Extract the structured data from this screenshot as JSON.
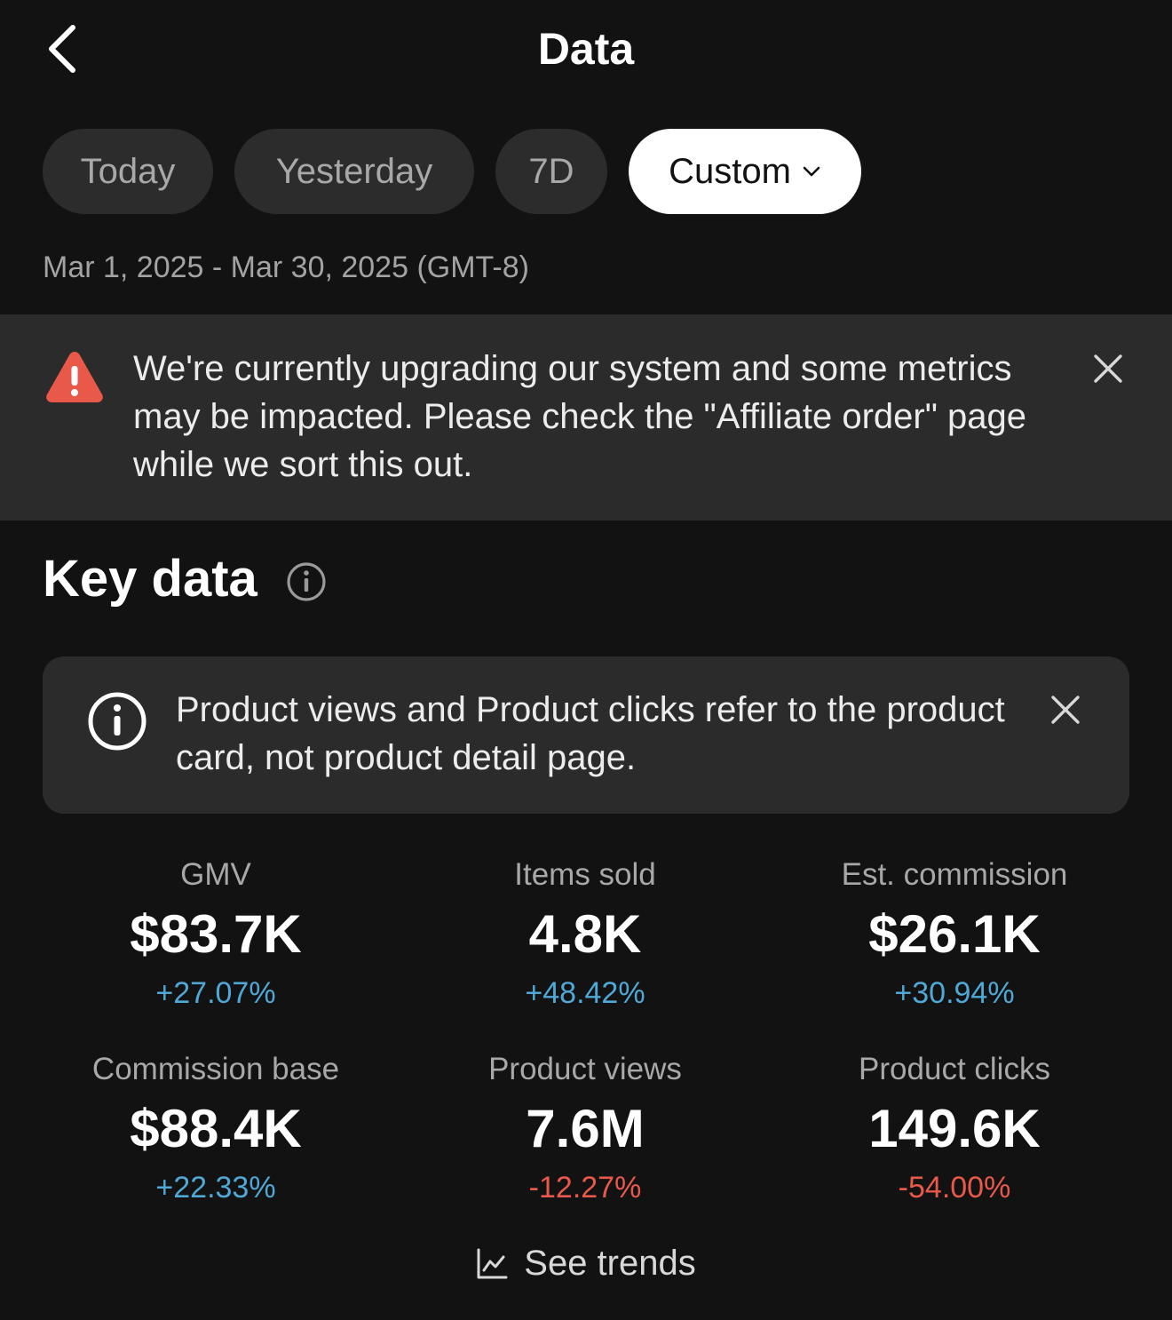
{
  "header": {
    "title": "Data"
  },
  "date_filter": {
    "chips": [
      {
        "label": "Today",
        "active": false
      },
      {
        "label": "Yesterday",
        "active": false
      },
      {
        "label": "7D",
        "active": false
      },
      {
        "label": "Custom",
        "active": true
      }
    ],
    "range_text": "Mar 1, 2025 - Mar 30, 2025 (GMT-8)"
  },
  "warning_banner": {
    "text": "We're currently upgrading our system and some metrics may be impacted. Please check the \"Affiliate order\" page while we sort this out."
  },
  "key_data": {
    "title": "Key data",
    "info_note": "Product views and Product clicks refer to the product card, not product detail page.",
    "metrics": [
      {
        "label": "GMV",
        "value": "$83.7K",
        "change": "+27.07%",
        "trend": "up"
      },
      {
        "label": "Items sold",
        "value": "4.8K",
        "change": "+48.42%",
        "trend": "up"
      },
      {
        "label": "Est. commission",
        "value": "$26.1K",
        "change": "+30.94%",
        "trend": "up"
      },
      {
        "label": "Commission base",
        "value": "$88.4K",
        "change": "+22.33%",
        "trend": "up"
      },
      {
        "label": "Product views",
        "value": "7.6M",
        "change": "-12.27%",
        "trend": "down"
      },
      {
        "label": "Product clicks",
        "value": "149.6K",
        "change": "-54.00%",
        "trend": "down"
      }
    ],
    "see_trends_label": "See trends"
  },
  "colors": {
    "background": "#121212",
    "banner": "#2b2b2b",
    "positive": "#4fa8d5",
    "negative": "#e8594a",
    "warning": "#e8594a"
  }
}
